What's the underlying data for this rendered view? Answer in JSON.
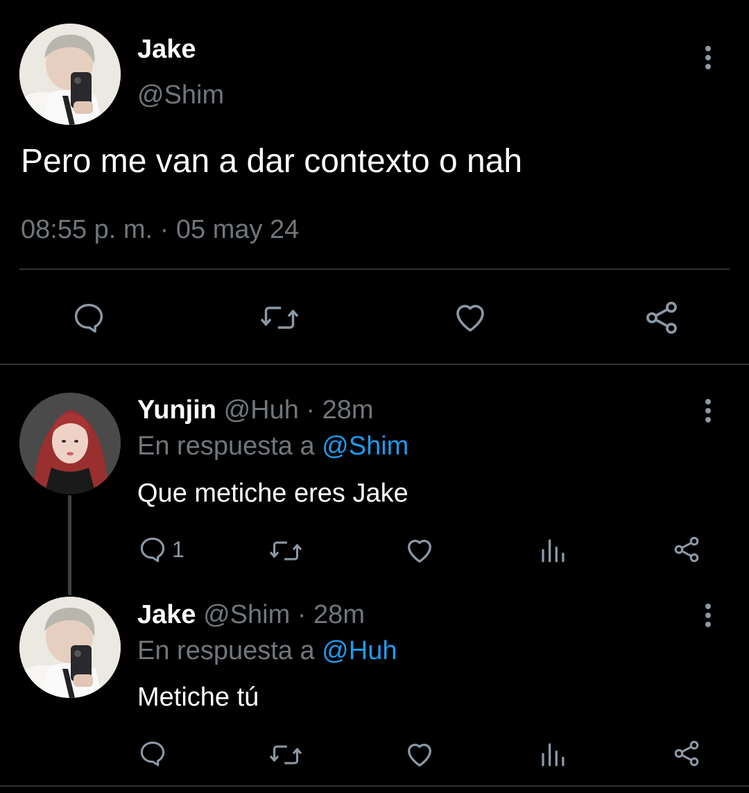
{
  "main_tweet": {
    "author_name": "Jake",
    "author_handle": "@Shim",
    "text": "Pero me van a dar contexto o nah",
    "timestamp": "08:55 p. m. · 05 may 24",
    "actions": [
      "reply-icon",
      "retweet-icon",
      "like-icon",
      "share-icon"
    ]
  },
  "replies": [
    {
      "name": "Yunjin",
      "handle": "@Huh",
      "time": "28m",
      "reply_prefix": "En respuesta a",
      "reply_to": "@Shim",
      "text": "Que metiche eres Jake",
      "reply_count": "1",
      "actions": [
        "reply-icon",
        "retweet-icon",
        "like-icon",
        "analytics-icon",
        "share-icon"
      ]
    },
    {
      "name": "Jake",
      "handle": "@Shim",
      "time": "28m",
      "reply_prefix": "En respuesta a",
      "reply_to": "@Huh",
      "text": "Metiche tú",
      "reply_count": "",
      "actions": [
        "reply-icon",
        "retweet-icon",
        "like-icon",
        "analytics-icon",
        "share-icon"
      ]
    }
  ],
  "separator": " · ",
  "colors": {
    "background": "#000000",
    "text": "#ffffff",
    "muted": "#71767b",
    "accent": "#1d9bf0",
    "icon": "#8b98a5",
    "divider": "#2f3336"
  }
}
